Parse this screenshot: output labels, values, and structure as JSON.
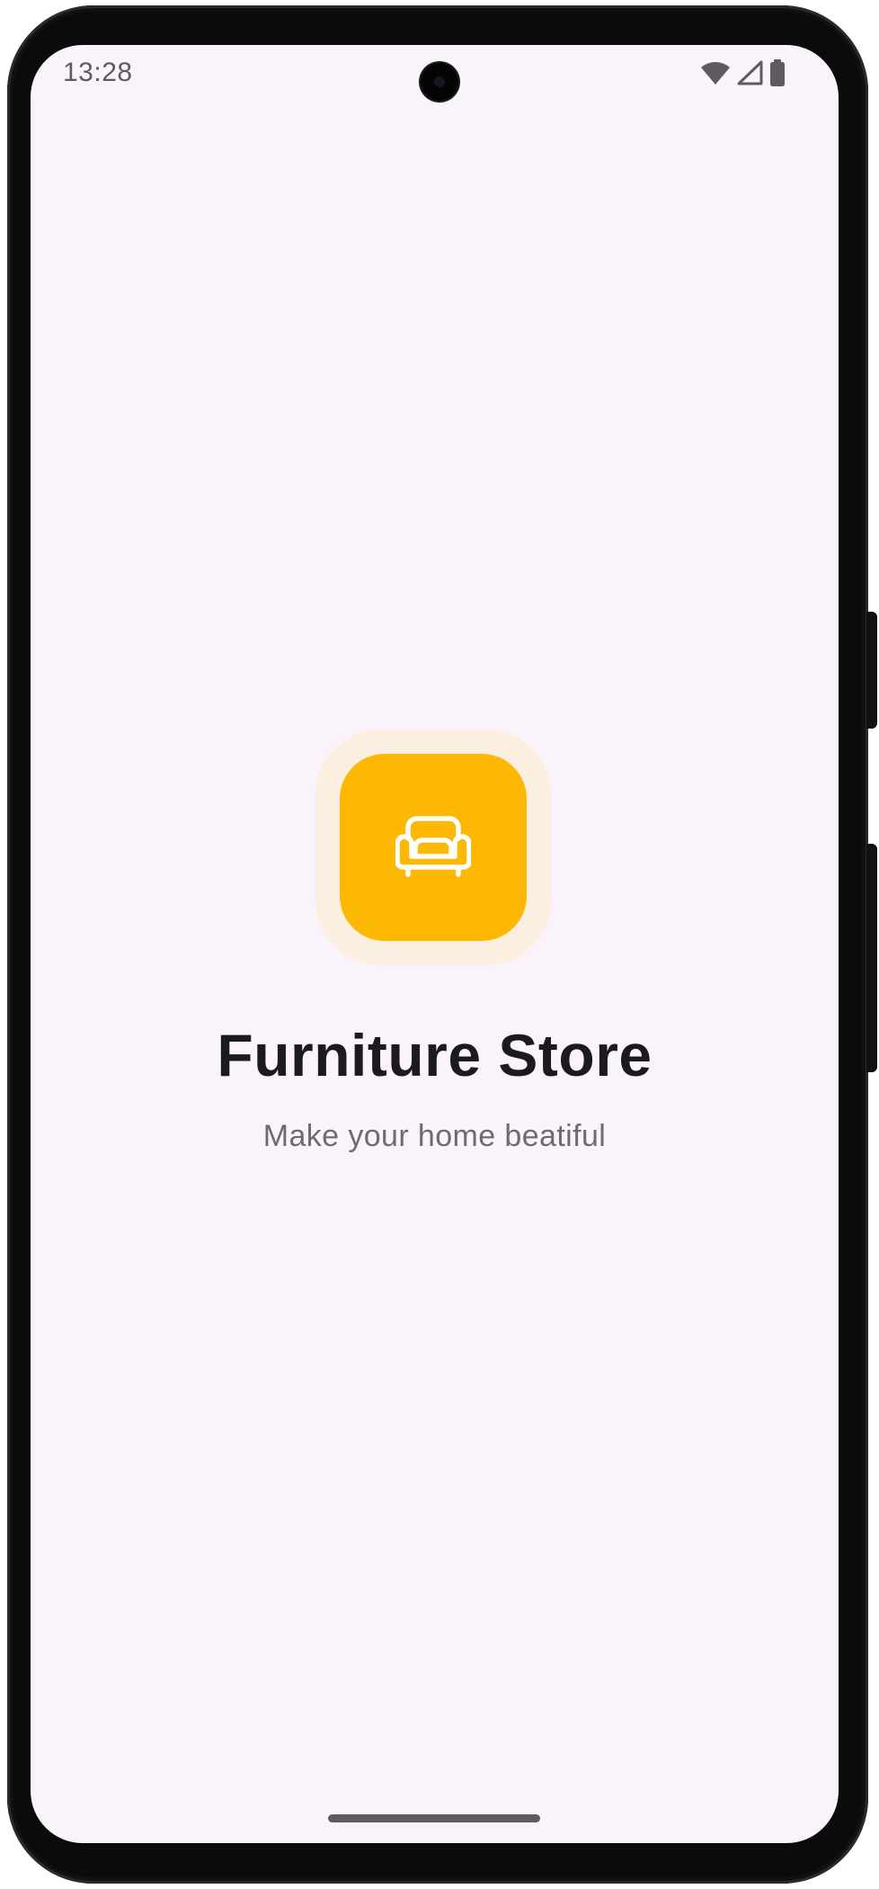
{
  "status_bar": {
    "time": "13:28",
    "icons": [
      "wifi-icon",
      "cellular-signal-icon",
      "battery-icon"
    ]
  },
  "splash": {
    "logo_icon": "sofa-icon",
    "title": "Furniture Store",
    "subtitle": "Make your home beatiful"
  },
  "colors": {
    "screen_background": "#fbf3fb",
    "logo_halo": "#fcefe0",
    "logo_tile": "#fdb705",
    "title_text": "#1b1b1d",
    "subtitle_text": "#6f6a70"
  }
}
